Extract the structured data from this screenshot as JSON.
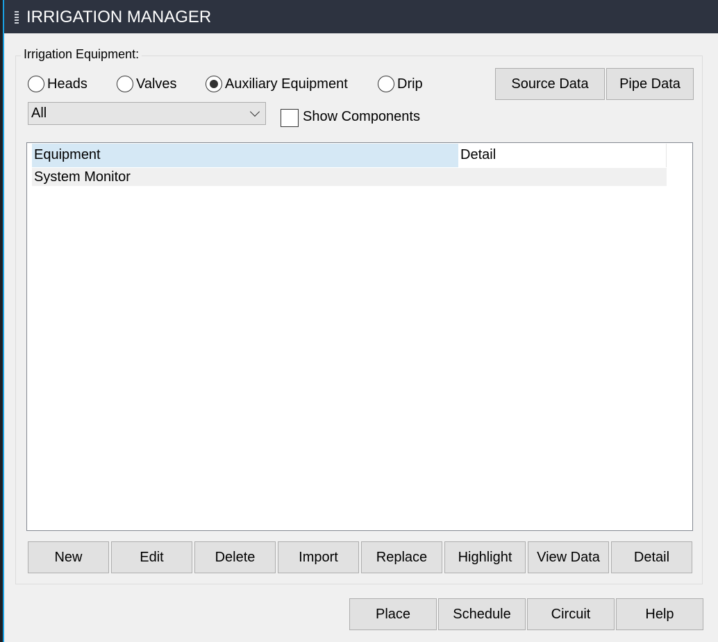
{
  "window": {
    "title": "IRRIGATION MANAGER"
  },
  "group": {
    "label": "Irrigation Equipment:"
  },
  "radios": [
    {
      "label": "Heads",
      "checked": false
    },
    {
      "label": "Valves",
      "checked": false
    },
    {
      "label": "Auxiliary Equipment",
      "checked": true
    },
    {
      "label": "Drip",
      "checked": false
    }
  ],
  "top_buttons": {
    "source": "Source Data",
    "pipe": "Pipe Data"
  },
  "filter": {
    "value": "All"
  },
  "show_components": {
    "label": "Show Components",
    "checked": false
  },
  "list": {
    "columns": [
      "Equipment",
      "Detail"
    ],
    "rows": [
      {
        "equipment": "System Monitor",
        "detail": ""
      }
    ]
  },
  "list_buttons": [
    "New",
    "Edit",
    "Delete",
    "Import",
    "Replace",
    "Highlight",
    "View Data",
    "Detail"
  ],
  "footer_buttons": [
    "Place",
    "Schedule",
    "Circuit",
    "Help"
  ],
  "colors": {
    "titlebar": "#2d3340",
    "header_highlight": "#d5e8f5",
    "accent": "#1a9fe0"
  }
}
